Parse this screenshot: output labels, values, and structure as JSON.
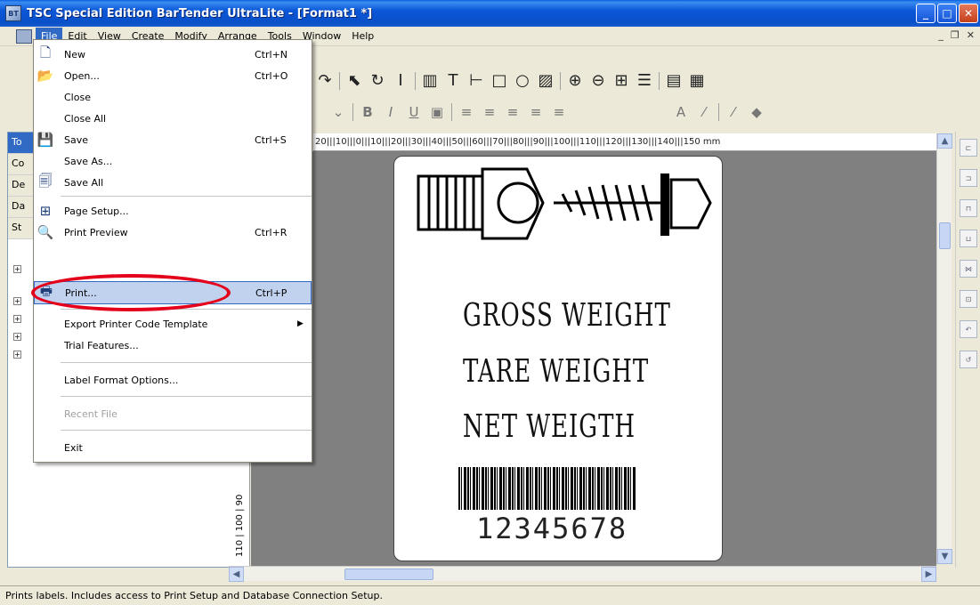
{
  "window": {
    "title": "TSC Special Edition BarTender UltraLite - [Format1 *]",
    "icon": "bartender-app-icon",
    "controls": [
      "minimize",
      "maximize",
      "close"
    ]
  },
  "menubar": {
    "items": [
      "File",
      "Edit",
      "View",
      "Create",
      "Modify",
      "Arrange",
      "Tools",
      "Window",
      "Help"
    ],
    "active": "File"
  },
  "file_menu": {
    "items": [
      {
        "label": "New",
        "shortcut": "Ctrl+N",
        "icon": "new-doc-icon"
      },
      {
        "label": "Open...",
        "shortcut": "Ctrl+O",
        "icon": "open-folder-icon"
      },
      {
        "label": "Close",
        "shortcut": "",
        "icon": ""
      },
      {
        "label": "Close All",
        "shortcut": "",
        "icon": ""
      },
      {
        "label": "Save",
        "shortcut": "Ctrl+S",
        "icon": "save-icon"
      },
      {
        "label": "Save As...",
        "shortcut": "",
        "icon": ""
      },
      {
        "label": "Save All",
        "shortcut": "",
        "icon": "save-all-icon"
      },
      {
        "label": "Page Setup...",
        "shortcut": "",
        "icon": "page-setup-icon"
      },
      {
        "label": "Print Preview",
        "shortcut": "Ctrl+R",
        "icon": "print-preview-icon"
      },
      {
        "label": "Print...",
        "shortcut": "Ctrl+P",
        "icon": "printer-icon"
      },
      {
        "label": "Export Printer Code Template",
        "shortcut": "",
        "icon": ""
      },
      {
        "label": "Trial Features...",
        "shortcut": "",
        "icon": ""
      },
      {
        "label": "Label Format Options...",
        "shortcut": "",
        "icon": ""
      },
      {
        "label": "Recent File",
        "shortcut": "",
        "icon": ""
      },
      {
        "label": "Exit",
        "shortcut": "",
        "icon": ""
      }
    ]
  },
  "left_panel": {
    "tabs": [
      "To",
      "Co",
      "De",
      "Da",
      "St"
    ]
  },
  "ruler": {
    "horizontal": "20|||10|||0|||10|||20|||30|||40|||50|||60|||70|||80|||90|||100|||110|||120|||130|||140|||150 mm",
    "vertical": "110 | 100 | 90"
  },
  "label": {
    "lines": [
      "GROSS WEIGHT",
      "TARE WEIGHT",
      "NET WEIGTH"
    ],
    "barcode_number": "12345678"
  },
  "statusbar": {
    "text": "Prints labels. Includes access to Print Setup and Database Connection Setup."
  },
  "highlight_color": "#e4001b"
}
